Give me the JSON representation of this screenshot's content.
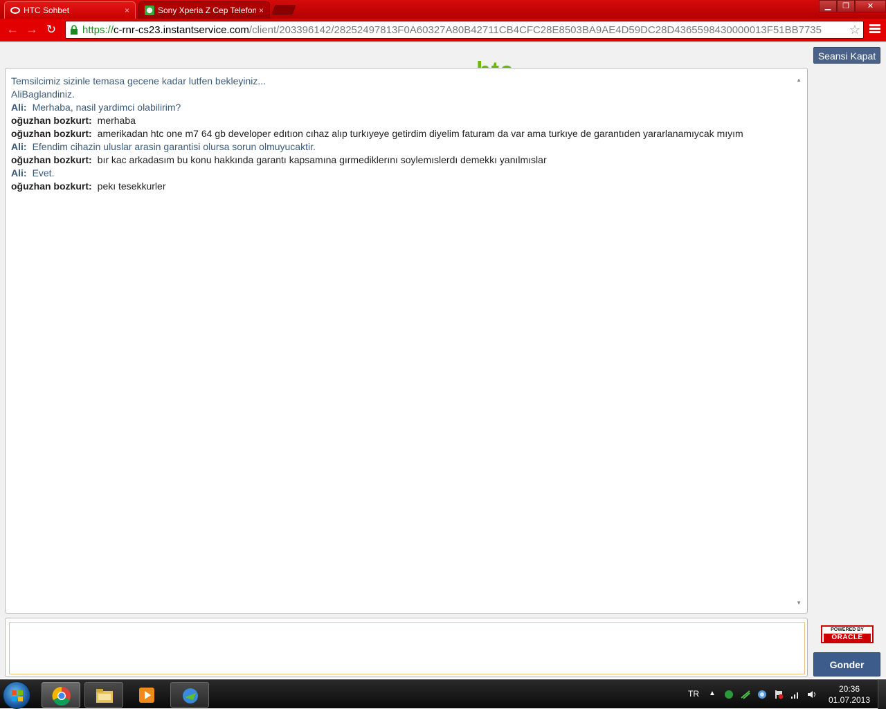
{
  "browser": {
    "tabs": [
      {
        "label": "HTC Sohbet",
        "close": "×"
      },
      {
        "label": "Sony Xperia Z Cep Telefon",
        "close": "×"
      }
    ],
    "url": {
      "scheme": "https://",
      "host": "c-rnr-cs23.instantservice.com",
      "path": "/client/203396142/28252497813F0A60327A80B42711CB4CFC28E8503BA9AE4D59DC28D4365598430000013F51BB7735"
    },
    "window_buttons": {
      "minimize": "▁",
      "maximize": "❐",
      "close": "✕"
    },
    "star": "☆"
  },
  "page": {
    "logo_text": "htc",
    "end_session_label": "Seansi Kapat",
    "messages": [
      {
        "type": "sys",
        "text": "Temsilcimiz sizinle temasa gecene kadar lutfen bekleyiniz..."
      },
      {
        "type": "sys",
        "text": "AliBaglandiniz."
      },
      {
        "type": "agent",
        "who": "Ali:",
        "text": "Merhaba, nasil yardimci olabilirim?"
      },
      {
        "type": "user",
        "who": "oğuzhan bozkurt:",
        "text": "merhaba"
      },
      {
        "type": "user",
        "who": "oğuzhan bozkurt:",
        "text": "amerikadan htc one m7 64 gb developer edıtıon cıhaz alıp turkıyeye getirdim diyelim faturam da var ama turkıye de garantıden yararlanamıycak mıyım"
      },
      {
        "type": "agent",
        "who": "Ali:",
        "text": "Efendim cihazin uluslar arasin garantisi olursa sorun olmuyucaktir."
      },
      {
        "type": "user",
        "who": "oğuzhan bozkurt:",
        "text": "bır kac arkadasım bu konu hakkında garantı kapsamına gırmediklerını soylemıslerdı demekkı yanılmıslar"
      },
      {
        "type": "agent",
        "who": "Ali:",
        "text": "Evet."
      },
      {
        "type": "user",
        "who": "oğuzhan bozkurt:",
        "text": "pekı tesekkurler"
      }
    ],
    "input_value": "",
    "powered_by": "POWERED BY",
    "oracle": "ORACLE",
    "send_label": "Gonder"
  },
  "taskbar": {
    "language": "TR",
    "time": "20:36",
    "date": "01.07.2013"
  },
  "colors": {
    "chrome_red": "#e20000",
    "agent_text": "#3a5a7a",
    "button_blue": "#3d5c8c",
    "htc_green": "#6cb80a"
  }
}
